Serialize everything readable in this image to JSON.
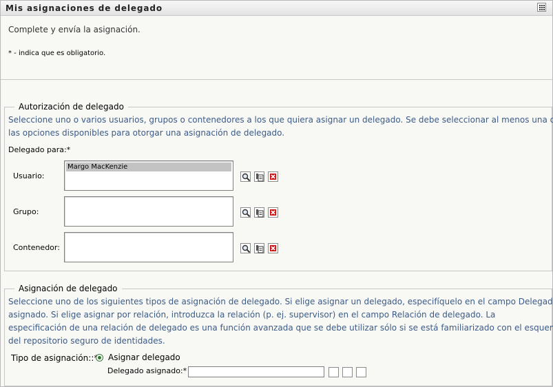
{
  "window": {
    "title": "Mis asignaciones de delegado",
    "grid_icon": "grid-icon"
  },
  "intro": {
    "text": "Complete y envía la asignación.",
    "required_note": "* - indica que es obligatorio."
  },
  "authorization": {
    "legend": "Autorización de delegado",
    "description_line1": "Seleccione uno o varios usuarios, grupos o contenedores a los que quiera asignar un delegado. Se debe seleccionar al menos una de",
    "description_line2": "las opciones disponibles para otorgar una asignación de delegado.",
    "delegate_for_label": "Delegado para:*",
    "rows": [
      {
        "label": "Usuario:",
        "selected": "Margo MacKenzie"
      },
      {
        "label": "Grupo:",
        "selected": ""
      },
      {
        "label": "Contenedor:",
        "selected": ""
      }
    ],
    "icons": [
      "search-icon",
      "history-icon",
      "delete-icon"
    ]
  },
  "assignment": {
    "legend": "Asignación de delegado",
    "description_lines": [
      "Seleccione uno de los siguientes tipos de asignación de delegado. Si elige asignar un delegado, especifíquelo en el campo Delegado",
      "asignado. Si elige asignar por relación, introduzca la relación (p. ej. supervisor) en el campo Relación de delegado. La",
      "especificación de una relación de delegado es una función avanzada que se debe utilizar sólo si se está familiarizado con el esquema",
      "del repositorio seguro de identidades."
    ],
    "type_label": "Tipo de asignación::*",
    "type_option": "Asignar delegado",
    "next_label": "Delegado asignado:*"
  },
  "colors": {
    "description_text": "#3b5b88",
    "background": "#f8f8f4",
    "delete_red": "#cc1111"
  }
}
